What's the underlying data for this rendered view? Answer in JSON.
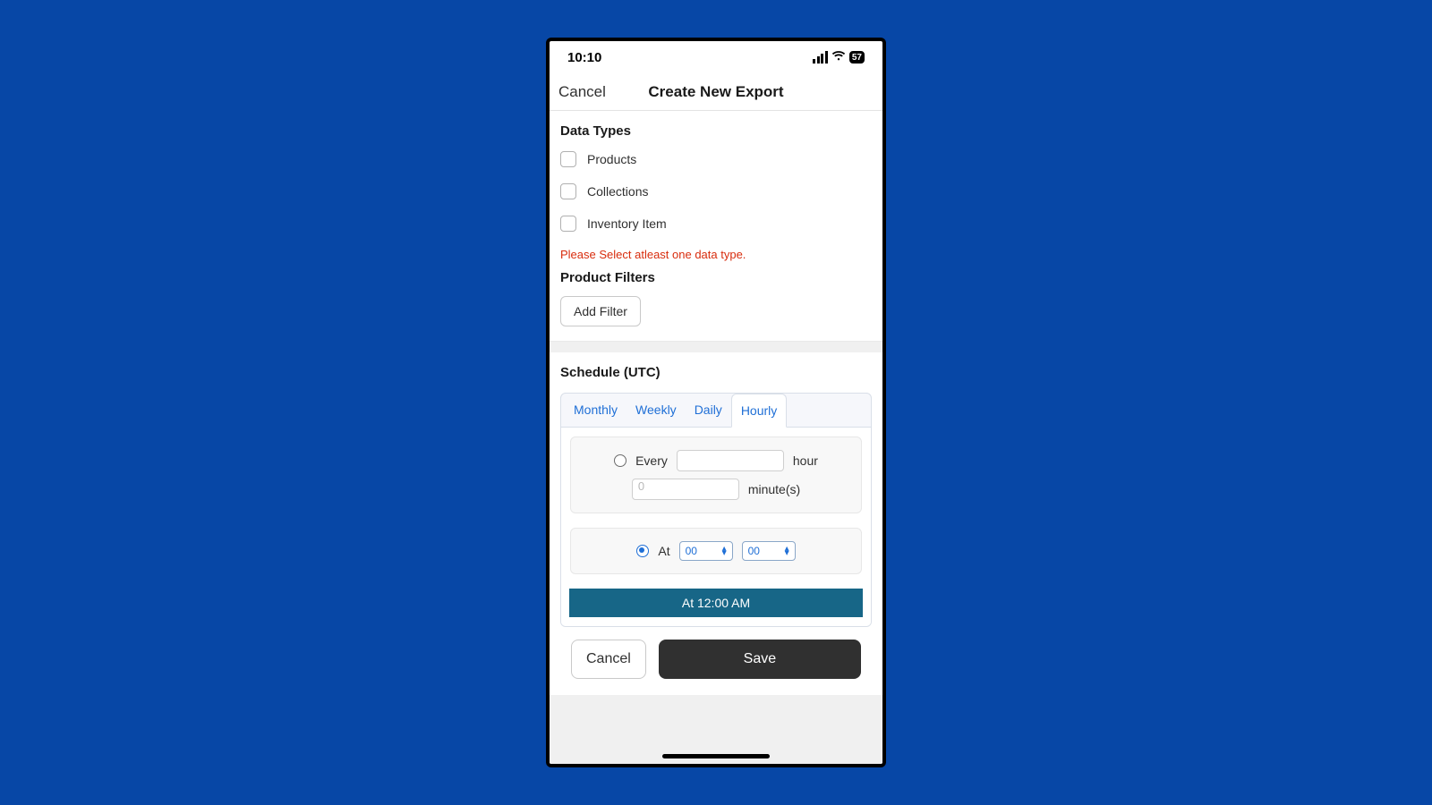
{
  "status": {
    "time": "10:10",
    "battery": "57"
  },
  "nav": {
    "cancel": "Cancel",
    "title": "Create New Export"
  },
  "dataTypes": {
    "title": "Data Types",
    "items": [
      "Products",
      "Collections",
      "Inventory Item"
    ],
    "error": "Please Select atleast one data type."
  },
  "filters": {
    "title": "Product Filters",
    "addBtn": "Add Filter"
  },
  "schedule": {
    "title": "Schedule (UTC)",
    "tabs": [
      "Monthly",
      "Weekly",
      "Daily",
      "Hourly"
    ],
    "activeTab": 3,
    "every": {
      "label1": "Every",
      "hourVal": "",
      "label2": "hour",
      "minPlaceholder": "0",
      "label3": "minute(s)"
    },
    "at": {
      "label": "At",
      "hour": "00",
      "minute": "00"
    },
    "summary": "At 12:00 AM"
  },
  "footer": {
    "cancel": "Cancel",
    "save": "Save"
  }
}
